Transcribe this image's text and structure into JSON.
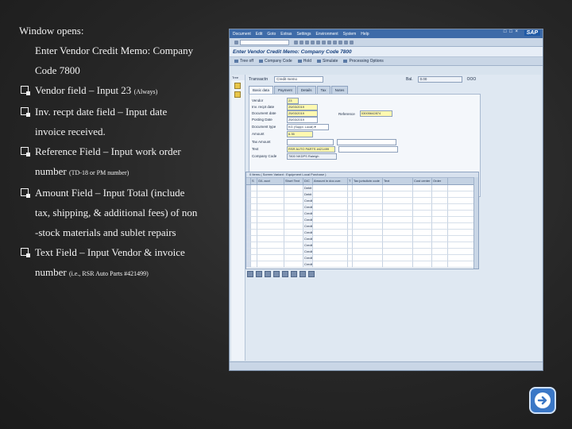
{
  "instructions": {
    "intro": "Window opens:",
    "title_line1": "Enter Vendor Credit Memo:  Company",
    "title_line2": "Code 7800",
    "bullets": [
      {
        "main": "Vendor field – Input 23 ",
        "small": "(Always)"
      },
      {
        "main": "Inv. recpt date field – Input date",
        "cont": "invoice received."
      },
      {
        "main": "Reference Field – Input work order",
        "cont": "number ",
        "small": "(TD-18 or PM number)"
      },
      {
        "main": "Amount Field – Input Total (include",
        "cont": "tax, shipping, & additional fees) of non",
        "cont2": "-stock materials and sublet repairs"
      },
      {
        "main": "Text Field – Input Vendor  & invoice",
        "cont": "number ",
        "small": "(i.e., RSR Auto Parts #421499)"
      }
    ]
  },
  "sap_window": {
    "logo": "SAP",
    "window_controls": "□ □ ×",
    "menu": [
      "Document",
      "Edit",
      "Goto",
      "Extras",
      "Settings",
      "Environment",
      "System",
      "Help"
    ],
    "title": "Enter Vendor Credit Memo: Company Code 7800",
    "app_toolbar": [
      "Tree off",
      "Company Code",
      "Hold",
      "Simulate",
      "Processing Options"
    ],
    "tree": {
      "label": "Tree"
    },
    "transaction_label": "Transactn",
    "transaction_value": "Credit memo",
    "balance_label": "Bal.",
    "balance_value": "0.00",
    "balance_status": "OOO",
    "tabs": [
      "Basic data",
      "Payment",
      "Details",
      "Tax",
      "Notes"
    ],
    "form": {
      "vendor_label": "Vendor",
      "vendor_value": "23",
      "inv_date_label": "Inv. recpt date",
      "inv_date_value": "25/03/2019",
      "doc_date_label": "Document date",
      "doc_date_value": "25/03/2019",
      "posting_label": "Posting Date",
      "posting_value": "25/03/2019",
      "reference_label": "Reference",
      "reference_value": "03005642874",
      "doc_type_label": "Document type",
      "doc_type_value": "KG (Suppl. Local) ▾",
      "amount_label": "Amount",
      "amount_value": "6.35",
      "tax_amount_label": "Tax Amount",
      "text_label": "Text",
      "text_value": "RSR AUTO PARTS #421499",
      "company_code_label": "Company Code",
      "company_code_value": "7800 NKDPS Raleigh"
    },
    "grid": {
      "title": "0 Items ( Screen Variant : Equipment Local Purchase )",
      "headers": [
        "",
        "S",
        "G/L acct",
        "Short Text",
        "D/C",
        "Amount in doc.curr.",
        "T",
        "Tax jurisdictn code",
        "Text",
        "Cost center",
        "Order",
        ""
      ],
      "rows": [
        [
          "",
          "",
          "",
          "",
          "Debit",
          "",
          "",
          "",
          "",
          "",
          "",
          ""
        ],
        [
          "",
          "",
          "",
          "",
          "Debit",
          "",
          "",
          "",
          "",
          "",
          "",
          ""
        ],
        [
          "",
          "",
          "",
          "",
          "Credit",
          "",
          "",
          "",
          "",
          "",
          "",
          ""
        ],
        [
          "",
          "",
          "",
          "",
          "Credit",
          "",
          "",
          "",
          "",
          "",
          "",
          ""
        ],
        [
          "",
          "",
          "",
          "",
          "Credit",
          "",
          "",
          "",
          "",
          "",
          "",
          ""
        ],
        [
          "",
          "",
          "",
          "",
          "Credit",
          "",
          "",
          "",
          "",
          "",
          "",
          ""
        ],
        [
          "",
          "",
          "",
          "",
          "Credit",
          "",
          "",
          "",
          "",
          "",
          "",
          ""
        ],
        [
          "",
          "",
          "",
          "",
          "Credit",
          "",
          "",
          "",
          "",
          "",
          "",
          ""
        ],
        [
          "",
          "",
          "",
          "",
          "Credit",
          "",
          "",
          "",
          "",
          "",
          "",
          ""
        ],
        [
          "",
          "",
          "",
          "",
          "Credit",
          "",
          "",
          "",
          "",
          "",
          "",
          ""
        ],
        [
          "",
          "",
          "",
          "",
          "Credit",
          "",
          "",
          "",
          "",
          "",
          "",
          ""
        ],
        [
          "",
          "",
          "",
          "",
          "Credit",
          "",
          "",
          "",
          "",
          "",
          "",
          ""
        ],
        [
          "",
          "",
          "",
          "",
          "Credit",
          "",
          "",
          "",
          "",
          "",
          "",
          ""
        ]
      ]
    }
  },
  "colors": {
    "accent": "#3a77c6",
    "background": "#262626",
    "required_field": "#fff9b0"
  },
  "next_icon": "arrow-right-icon"
}
